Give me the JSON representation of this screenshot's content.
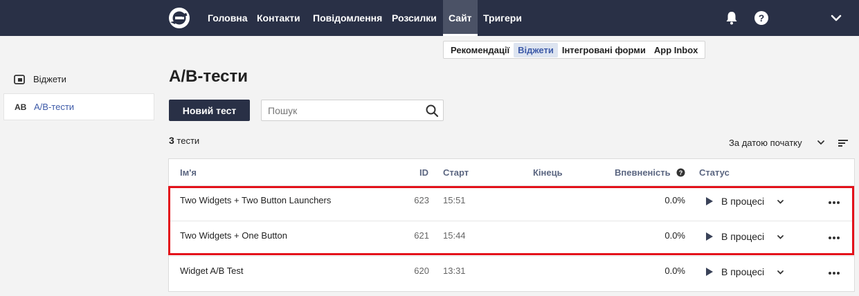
{
  "nav": {
    "items": [
      {
        "label": "Головна"
      },
      {
        "label": "Контакти"
      },
      {
        "label": "Повідомлення"
      },
      {
        "label": "Розсилки"
      },
      {
        "label": "Сайт"
      },
      {
        "label": "Тригери"
      }
    ],
    "active": "Сайт"
  },
  "subnav": {
    "items": [
      {
        "label": "Рекомендації"
      },
      {
        "label": "Віджети"
      },
      {
        "label": "Інтегровані форми"
      },
      {
        "label": "App Inbox"
      }
    ],
    "active": "Віджети"
  },
  "sidebar": {
    "items": [
      {
        "label": "Віджети",
        "icon": "widget-icon"
      },
      {
        "label": "A/B-тести",
        "badge": "AB"
      }
    ]
  },
  "main": {
    "title": "A/B-тести",
    "new_button": "Новий тест",
    "search_placeholder": "Пошук",
    "count_number": "3",
    "count_label": "тести",
    "sort_label": "За датою початку"
  },
  "table": {
    "headers": {
      "name": "Ім'я",
      "id": "ID",
      "start": "Старт",
      "end": "Кінець",
      "confidence": "Впевненість",
      "status": "Статус"
    },
    "rows": [
      {
        "name": "Two Widgets + Two Button Launchers",
        "id": "623",
        "start": "15:51",
        "end": "",
        "confidence": "0.0%",
        "status": "В процесі"
      },
      {
        "name": "Two Widgets + One Button",
        "id": "621",
        "start": "15:44",
        "end": "",
        "confidence": "0.0%",
        "status": "В процесі"
      },
      {
        "name": "Widget A/B Test",
        "id": "620",
        "start": "13:31",
        "end": "",
        "confidence": "0.0%",
        "status": "В процесі"
      }
    ]
  },
  "colors": {
    "nav_bg": "#293046",
    "accent": "#3d5aa8",
    "highlight": "#e3111a"
  }
}
